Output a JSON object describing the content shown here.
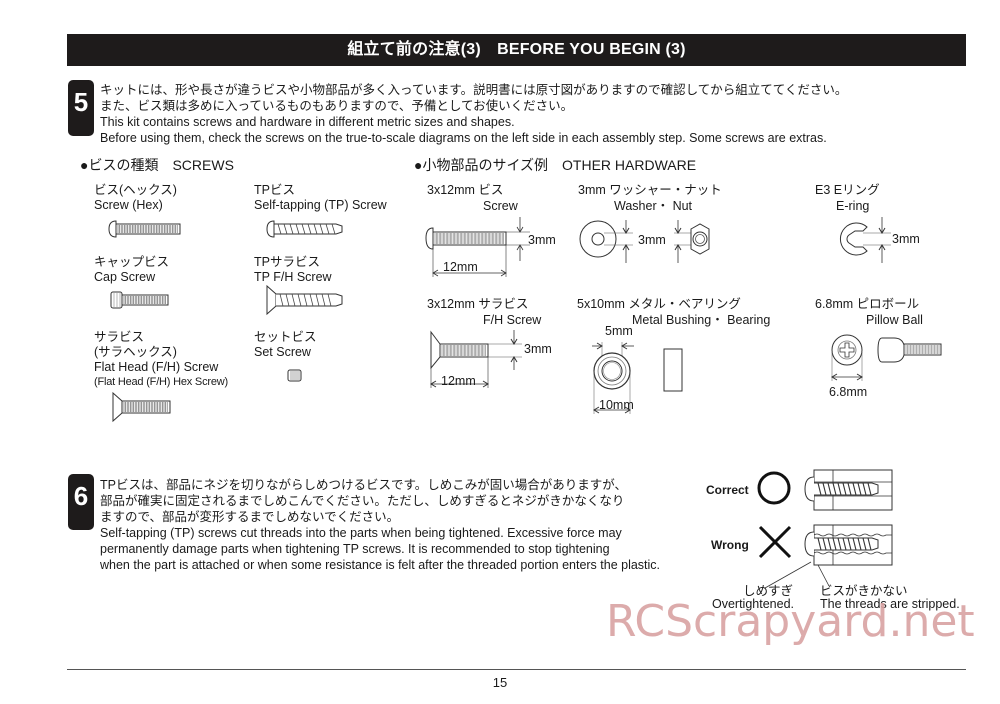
{
  "header": {
    "title": "組立て前の注意(3)　BEFORE YOU BEGIN (3)"
  },
  "step5": {
    "number": "5",
    "lines": [
      "キットには、形や長さが違うビスや小物部品が多く入っています。説明書には原寸図がありますので確認してから組立ててください。",
      "また、ビス類は多めに入っているものもありますので、予備としてお使いください。",
      "This kit contains screws and hardware in different metric sizes and shapes.",
      "Before using them, check the screws on the true-to-scale diagrams on the left side in each assembly step.  Some screws are extras."
    ]
  },
  "screws": {
    "title": "●ビスの種類　SCREWS",
    "items": [
      {
        "jp": "ビス(ヘックス)",
        "en": "Screw (Hex)",
        "icon": "hex-screw-icon"
      },
      {
        "jp": "TPビス",
        "en": "Self-tapping (TP) Screw",
        "icon": "tp-screw-icon"
      },
      {
        "jp": "キャップビス",
        "en": "Cap Screw",
        "icon": "cap-screw-icon"
      },
      {
        "jp": "TPサラビス",
        "en": "TP F/H Screw",
        "icon": "tp-flat-head-screw-icon"
      },
      {
        "jp": "サラビス",
        "jp2": "(サラヘックス)",
        "en": "Flat Head (F/H) Screw",
        "en2": "(Flat Head (F/H) Hex Screw)",
        "icon": "flat-head-screw-icon"
      },
      {
        "jp": "セットビス",
        "en": "Set Screw",
        "icon": "set-screw-icon"
      }
    ]
  },
  "hardware": {
    "title": "●小物部品のサイズ例　OTHER HARDWARE",
    "screw": {
      "jp": "3x12mm ビス",
      "en": "Screw",
      "dim_diameter": "3mm",
      "dim_length": "12mm"
    },
    "washer_nut": {
      "jp": "3mm ワッシャー・ナット",
      "en": "Washer・ Nut",
      "dim": "3mm"
    },
    "ering": {
      "jp": "E3 Eリング",
      "en": "E-ring",
      "dim": "3mm"
    },
    "fh_screw": {
      "jp": "3x12mm サラビス",
      "en": "F/H Screw",
      "dim_diameter": "3mm",
      "dim_length": "12mm"
    },
    "bushing": {
      "jp": "5x10mm メタル・ベアリング",
      "en": "Metal Bushing・ Bearing",
      "dim_inner": "5mm",
      "dim_outer": "10mm"
    },
    "pillow_ball": {
      "jp": "6.8mm ピロボール",
      "en": "Pillow Ball",
      "dim": "6.8mm"
    }
  },
  "step6": {
    "number": "6",
    "lines": [
      "TPビスは、部品にネジを切りながらしめつけるビスです。しめこみが固い場合がありますが、",
      "部品が確実に固定されるまでしめこんでください。ただし、しめすぎるとネジがきかなくなり",
      "ますので、部品が変形するまでしめないでください。",
      "Self-tapping (TP) screws cut threads into the parts when being tightened.  Excessive force may",
      "permanently damage parts when tightening TP screws.  It is recommended to stop tightening",
      "when the part is attached or when some resistance is felt after the threaded portion enters the plastic."
    ],
    "correct_label": "Correct",
    "wrong_label": "Wrong",
    "overtightened_jp": "しめすぎ",
    "overtightened_en": "Overtightened.",
    "stripped_jp": "ビスがきかない",
    "stripped_en": "The threads are stripped."
  },
  "watermark": "RCScrapyard.net",
  "footer": {
    "page_number": "15"
  }
}
